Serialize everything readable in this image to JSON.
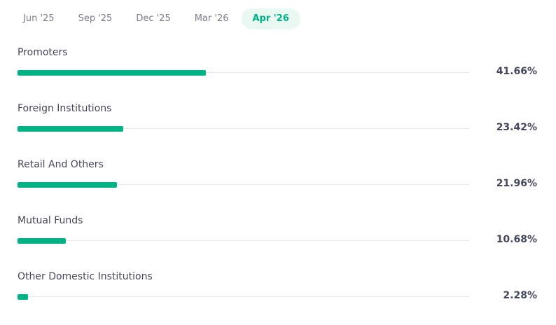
{
  "period_tabs": [
    {
      "label": "Jun '25",
      "active": false
    },
    {
      "label": "Sep '25",
      "active": false
    },
    {
      "label": "Dec '25",
      "active": false
    },
    {
      "label": "Mar '26",
      "active": false
    },
    {
      "label": "Apr '26",
      "active": true
    }
  ],
  "shareholding": [
    {
      "label": "Promoters",
      "value_text": "41.66%",
      "percent": 41.66
    },
    {
      "label": "Foreign Institutions",
      "value_text": "23.42%",
      "percent": 23.42
    },
    {
      "label": "Retail And Others",
      "value_text": "21.96%",
      "percent": 21.96
    },
    {
      "label": "Mutual Funds",
      "value_text": "10.68%",
      "percent": 10.68
    },
    {
      "label": "Other Domestic Institutions",
      "value_text": "2.28%",
      "percent": 2.28
    }
  ],
  "colors": {
    "accent": "#00b386",
    "accent_bg": "#e9f9f2",
    "track": "#e9e9eb",
    "text": "#44475b",
    "muted": "#7c7e8c"
  }
}
